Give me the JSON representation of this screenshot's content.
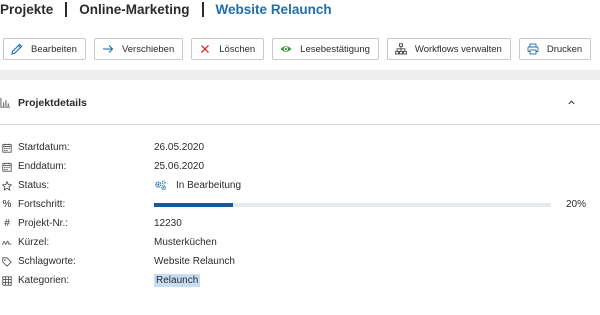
{
  "breadcrumb": [
    "Projekte",
    "Online-Marketing",
    "Website Relaunch"
  ],
  "toolbar": {
    "edit": "Bearbeiten",
    "move": "Verschieben",
    "delete": "Löschen",
    "read_receipt": "Lesebestätigung",
    "workflows": "Workflows verwalten",
    "print": "Drucken"
  },
  "panel": {
    "title": "Projektdetails",
    "fields": {
      "start_label": "Startdatum:",
      "start_value": "26.05.2020",
      "end_label": "Enddatum:",
      "end_value": "25.06.2020",
      "status_label": "Status:",
      "status_value": "In Bearbeitung",
      "progress_label": "Fortschritt:",
      "progress_value": 20,
      "progress_text": "20%",
      "project_no_label": "Projekt-Nr.:",
      "project_no_value": "12230",
      "short_label": "Kürzel:",
      "short_value": "Musterküchen",
      "keywords_label": "Schlagworte:",
      "keywords_value": "Website Relaunch",
      "categories_label": "Kategorien:",
      "categories_value": "Relaunch"
    }
  },
  "colors": {
    "accent": "#1f6fa8",
    "progress": "#1a5a94",
    "delete_icon": "#d9342b",
    "read_icon": "#3a9a3a"
  }
}
